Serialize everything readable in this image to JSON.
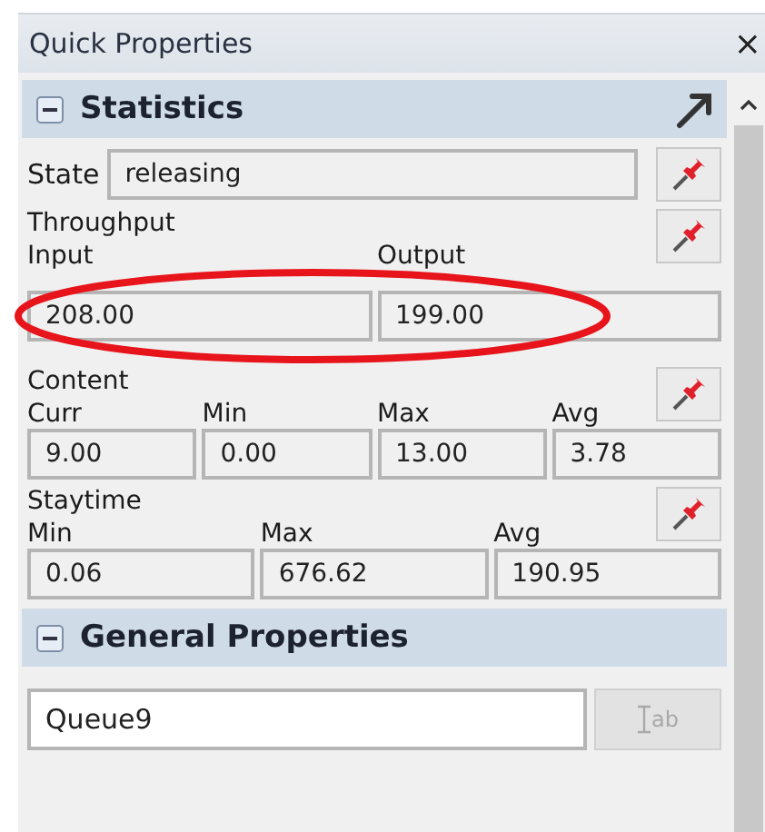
{
  "window": {
    "title": "Quick Properties",
    "close": "×"
  },
  "sections": [
    {
      "kind": "statistics",
      "title": "Statistics",
      "expanded": true,
      "state": {
        "label": "State",
        "value": "releasing"
      },
      "groups": [
        {
          "title": "Throughput",
          "fields": [
            {
              "label": "Input",
              "value": "208.00"
            },
            {
              "label": "Output",
              "value": "199.00"
            }
          ]
        },
        {
          "title": "Content",
          "fields": [
            {
              "label": "Curr",
              "value": "9.00"
            },
            {
              "label": "Min",
              "value": "0.00"
            },
            {
              "label": "Max",
              "value": "13.00"
            },
            {
              "label": "Avg",
              "value": "3.78"
            }
          ]
        },
        {
          "title": "Staytime",
          "fields": [
            {
              "label": "Min",
              "value": "0.06"
            },
            {
              "label": "Max",
              "value": "676.62"
            },
            {
              "label": "Avg",
              "value": "190.95"
            }
          ]
        }
      ]
    },
    {
      "kind": "general",
      "title": "General Properties",
      "expanded": true,
      "name": {
        "value": "Queue9"
      },
      "rename_button": {
        "label": "ab",
        "disabled": true
      }
    }
  ],
  "annotation": {
    "kind": "ellipse",
    "color": "#e8141c"
  }
}
